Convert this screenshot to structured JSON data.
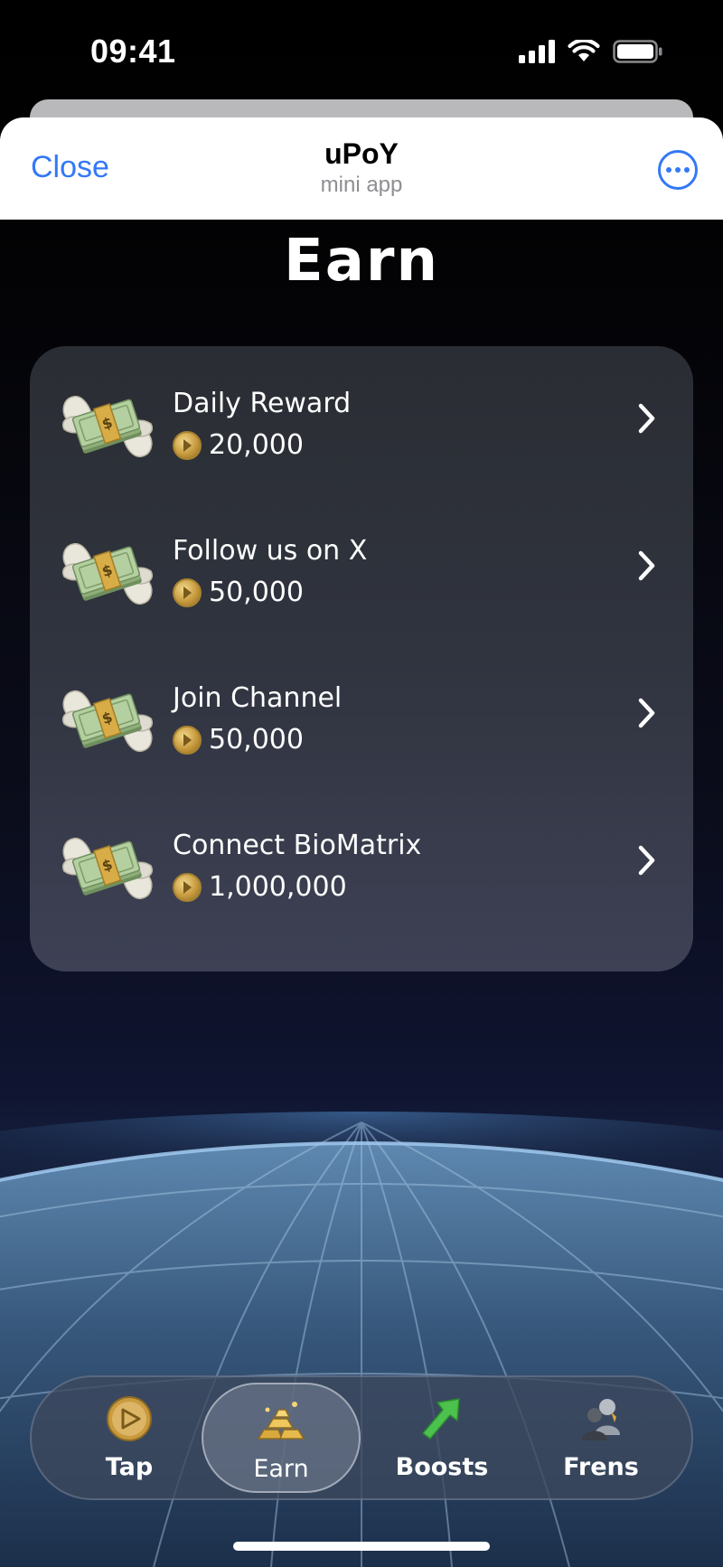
{
  "status_bar": {
    "time": "09:41",
    "icons": [
      "signal-icon",
      "wifi-icon",
      "battery-icon"
    ]
  },
  "header": {
    "close_label": "Close",
    "title": "uPoY",
    "subtitle": "mini app",
    "more_icon": "more-icon"
  },
  "page": {
    "title": "Earn"
  },
  "tasks": [
    {
      "name": "Daily Reward",
      "amount": "20,000",
      "icon": "money-with-wings-icon"
    },
    {
      "name": "Follow us on X",
      "amount": "50,000",
      "icon": "money-with-wings-icon"
    },
    {
      "name": "Join Channel",
      "amount": "50,000",
      "icon": "money-with-wings-icon"
    },
    {
      "name": "Connect BioMatrix",
      "amount": "1,000,000",
      "icon": "money-with-wings-icon"
    }
  ],
  "nav": {
    "active": "Earn",
    "items": [
      {
        "label": "Tap",
        "icon": "coin-icon"
      },
      {
        "label": "Earn",
        "icon": "gold-bars-icon"
      },
      {
        "label": "Boosts",
        "icon": "arrow-up-icon"
      },
      {
        "label": "Frens",
        "icon": "people-icon"
      }
    ]
  },
  "colors": {
    "accent": "#3478f6",
    "card_top": "#2a2d33",
    "card_bottom": "#3e4155",
    "coin": "#c79a3e"
  }
}
